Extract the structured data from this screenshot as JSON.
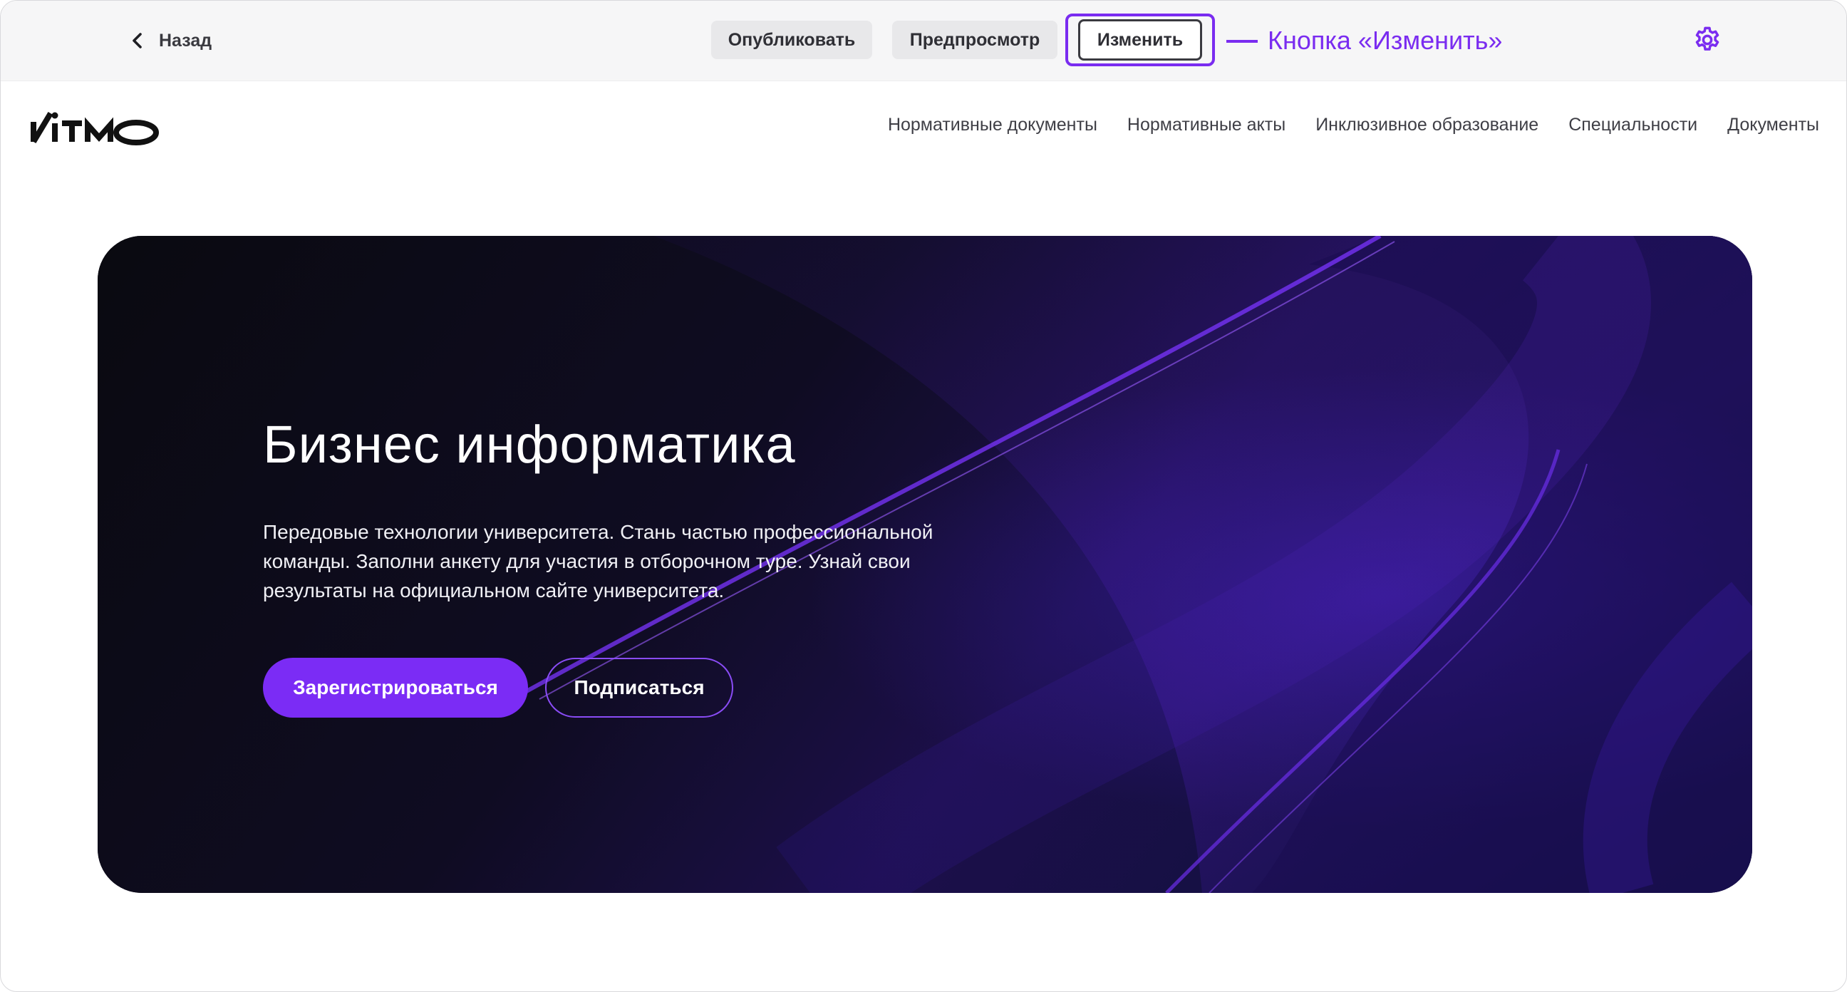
{
  "toolbar": {
    "back_label": "Назад",
    "publish_label": "Опубликовать",
    "preview_label": "Предпросмотр",
    "edit_label": "Изменить",
    "annotation": "Кнопка  «Изменить»"
  },
  "site": {
    "logo_text": "ITMO",
    "nav": [
      "Нормативные документы",
      "Нормативные акты",
      "Инклюзивное образование",
      "Специальности",
      "Документы"
    ]
  },
  "hero": {
    "title": "Бизнес информатика",
    "text": "Передовые технологии университета. Стань частью профессиональной команды. Заполни анкету для участия в отборочном туре. Узнай свои результаты на официальном сайте университета.",
    "register_label": "Зарегистрироваться",
    "subscribe_label": "Подписаться"
  },
  "colors": {
    "accent": "#7a2cf0",
    "hero_background": "#0b0b14",
    "primary_button": "#7b2cf5"
  },
  "icons": {
    "back": "chevron-left-icon",
    "settings": "gear-icon"
  }
}
